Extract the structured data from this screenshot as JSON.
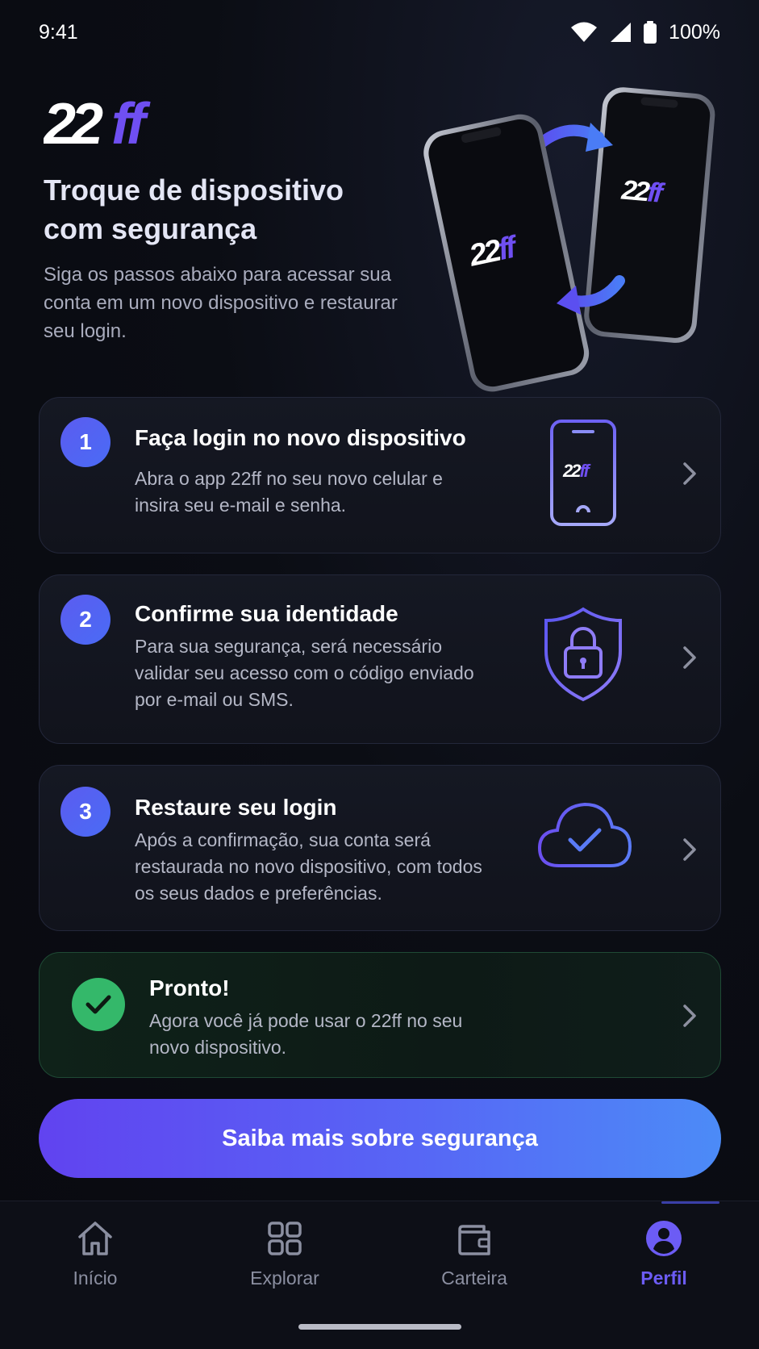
{
  "status_bar": {
    "time": "9:41",
    "battery": "100%"
  },
  "header": {
    "logo_text": "22ff",
    "title": "Troque de dispositivo com segurança",
    "subtitle": "Siga os passos abaixo para acessar sua conta em um novo dispositivo e restaurar seu login."
  },
  "steps": [
    {
      "number": "1",
      "title": "Faça login no novo dispositivo",
      "description": "Abra o app 22ff no seu novo celular e insira seu e-mail e senha.",
      "icon": "phone-icon"
    },
    {
      "number": "2",
      "title": "Confirme sua identidade",
      "description": "Para sua segurança, será necessário validar seu acesso com o código enviado por e-mail ou SMS.",
      "icon": "shield-lock-icon"
    },
    {
      "number": "3",
      "title": "Restaure seu login",
      "description": "Após a confirmação, sua conta será restaurada no novo dispositivo, com todos os seus dados e preferências.",
      "icon": "cloud-check-icon"
    }
  ],
  "ready": {
    "title": "Pronto!",
    "description": "Agora você já pode usar o 22ff no seu novo dispositivo."
  },
  "cta": {
    "label": "Saiba mais sobre segurança"
  },
  "nav": {
    "items": [
      {
        "label": "Início",
        "icon": "home-icon"
      },
      {
        "label": "Explorar",
        "icon": "grid-icon"
      },
      {
        "label": "Carteira",
        "icon": "wallet-icon"
      },
      {
        "label": "Perfil",
        "icon": "profile-icon",
        "active": true
      }
    ]
  },
  "colors": {
    "accent": "#6c5cf5",
    "success": "#34b86a",
    "background": "#0b0d14"
  }
}
